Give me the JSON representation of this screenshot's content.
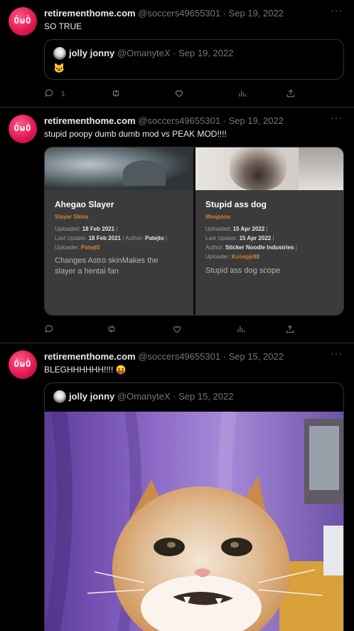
{
  "tweets": [
    {
      "name": "retirementhome.com",
      "handle": "@soccers49655301",
      "date": "· Sep 19, 2022",
      "text": "SO TRUE",
      "quote": {
        "name": "jolly jonny",
        "handle": "@OmanyteX",
        "date": "· Sep 19, 2022",
        "emoji": "🐱"
      },
      "reply_count": "1"
    },
    {
      "name": "retirementhome.com",
      "handle": "@soccers49655301",
      "date": "· Sep 19, 2022",
      "text": "stupid poopy dumb dumb mod vs PEAK MOD!!!!",
      "cards": [
        {
          "title": "Ahegao Slayer",
          "category": "Slayer Skins",
          "uploaded_label": "Uploaded:",
          "uploaded": "18 Feb 2021",
          "last_update_label": "Last Update:",
          "last_update": "18 Feb 2021",
          "author_label": "Author:",
          "author": "Patejto",
          "uploader_label": "Uploader:",
          "uploader": "Patejt0",
          "desc1": "Changes Astro skinMakes the",
          "desc2": "slayer a hentai fan"
        },
        {
          "title": "Stupid ass dog",
          "category": "Weapons",
          "uploaded_label": "Uploaded:",
          "uploaded": "15 Apr 2022",
          "last_update_label": "Last Update:",
          "last_update": "15 Apr 2022",
          "author_label": "Author:",
          "author": "Sticker Noodle Industries",
          "uploader_label": "Uploader:",
          "uploader": "Kcoopjr88",
          "desc1": "Stupid ass dog scope"
        }
      ]
    },
    {
      "name": "retirementhome.com",
      "handle": "@soccers49655301",
      "date": "· Sep 15, 2022",
      "text": "BLEGHHHHHH!!!! 😝",
      "quote": {
        "name": "jolly jonny",
        "handle": "@OmanyteX",
        "date": "· Sep 15, 2022"
      }
    }
  ],
  "avatar_face": "ÓωÒ",
  "colors": {
    "accent_orange": "#d8832a",
    "avatar_pink": "#e0164f"
  }
}
